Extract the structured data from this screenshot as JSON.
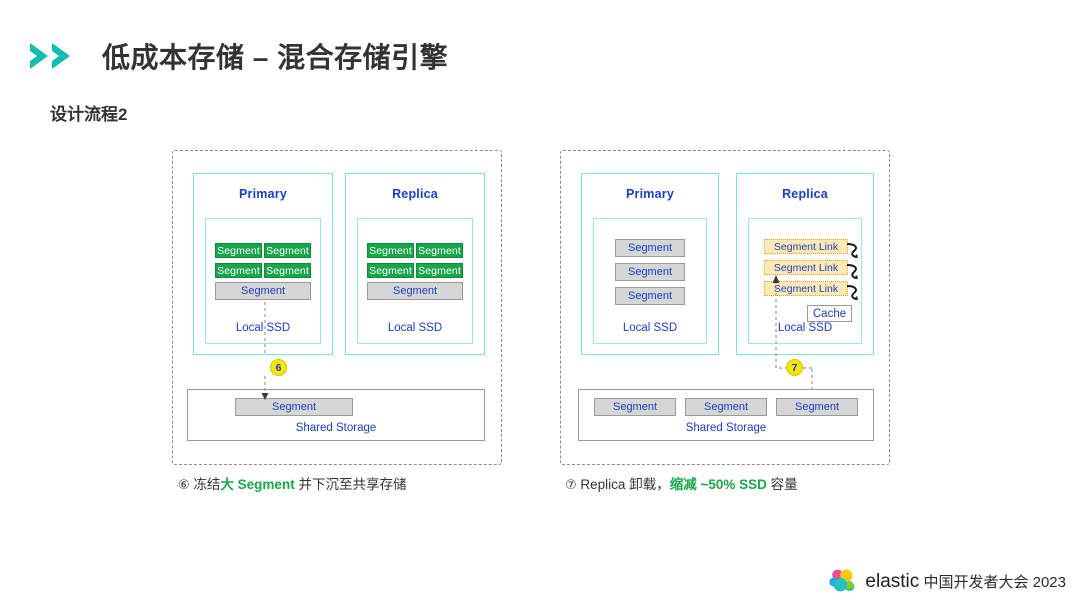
{
  "header": {
    "chevron_icon": "double-chevron-right-icon",
    "title": "低成本存储 – 混合存储引擎",
    "subtitle": "设计流程2",
    "accent_color": "#17bdb0"
  },
  "colors": {
    "green_segment": "#19a64a",
    "gray_segment": "#d6d6d6",
    "link_segment": "#fde9b5",
    "label_blue": "#1a3fc4",
    "panel_teal": "#7fe3da",
    "marker_yellow": "#ffe600",
    "highlight_green": "#19a64a"
  },
  "diagrams": [
    {
      "id": "left",
      "panels": [
        {
          "title": "Primary",
          "ssd_label": "Local SSD",
          "rows": [
            {
              "type": "green-pair",
              "cells": [
                "Segment",
                "Segment"
              ]
            },
            {
              "type": "green-pair",
              "cells": [
                "Segment",
                "Segment"
              ]
            },
            {
              "type": "gray-wide",
              "cells": [
                "Segment"
              ]
            }
          ]
        },
        {
          "title": "Replica",
          "ssd_label": "Local SSD",
          "rows": [
            {
              "type": "green-pair",
              "cells": [
                "Segment",
                "Segment"
              ]
            },
            {
              "type": "green-pair",
              "cells": [
                "Segment",
                "Segment"
              ]
            },
            {
              "type": "gray-wide",
              "cells": [
                "Segment"
              ]
            }
          ]
        }
      ],
      "storage": {
        "label": "Shared Storage",
        "segments": [
          "Segment"
        ]
      },
      "marker": "6"
    },
    {
      "id": "right",
      "panels": [
        {
          "title": "Primary",
          "ssd_label": "Local SSD",
          "rows": [
            {
              "type": "gray-mid",
              "cells": [
                "Segment"
              ]
            },
            {
              "type": "gray-mid",
              "cells": [
                "Segment"
              ]
            },
            {
              "type": "gray-mid",
              "cells": [
                "Segment"
              ]
            }
          ]
        },
        {
          "title": "Replica",
          "ssd_label": "Local SSD",
          "rows": [
            {
              "type": "link",
              "cells": [
                "Segment Link"
              ]
            },
            {
              "type": "link",
              "cells": [
                "Segment Link"
              ]
            },
            {
              "type": "link",
              "cells": [
                "Segment Link"
              ]
            }
          ],
          "cache_label": "Cache"
        }
      ],
      "storage": {
        "label": "Shared Storage",
        "segments": [
          "Segment",
          "Segment",
          "Segment"
        ]
      },
      "marker": "7"
    }
  ],
  "captions": {
    "left": {
      "number": "⑥",
      "pre": "冻结",
      "highlight": "大 Segment",
      "post": "并下沉至共享存储"
    },
    "right": {
      "number": "⑦",
      "pre": "Replica 卸载，",
      "highlight": "缩减 ~50% SSD",
      "post": "容量"
    }
  },
  "footer": {
    "logo_icon": "elastic-logo-icon",
    "brand": "elastic",
    "text": "中国开发者大会 2023"
  }
}
